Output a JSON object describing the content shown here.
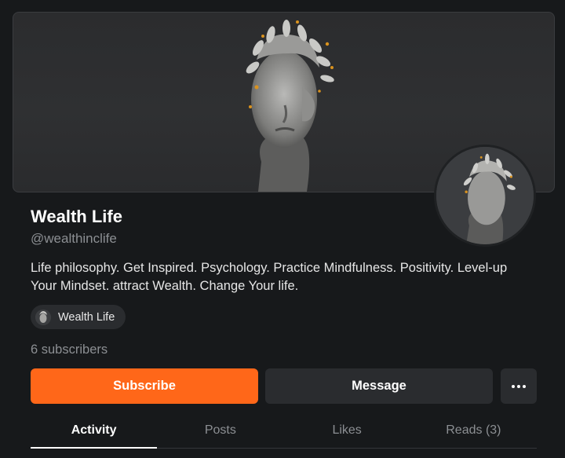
{
  "profile": {
    "name": "Wealth Life",
    "handle": "@wealthinclife",
    "bio": "Life philosophy. Get Inspired. Psychology. Practice Mindfulness. Positivity. Level-up Your Mindset. attract Wealth. Change Your life.",
    "publication_label": "Wealth Life",
    "subscribers": "6 subscribers"
  },
  "actions": {
    "subscribe_label": "Subscribe",
    "message_label": "Message",
    "more_icon": "more-horizontal-icon"
  },
  "tabs": [
    {
      "label": "Activity",
      "active": true
    },
    {
      "label": "Posts",
      "active": false
    },
    {
      "label": "Likes",
      "active": false
    },
    {
      "label": "Reads (3)",
      "active": false
    }
  ],
  "colors": {
    "background": "#17191b",
    "accent": "#ff6719",
    "secondary_button": "#2a2c2f",
    "muted_text": "#8c8f93"
  }
}
